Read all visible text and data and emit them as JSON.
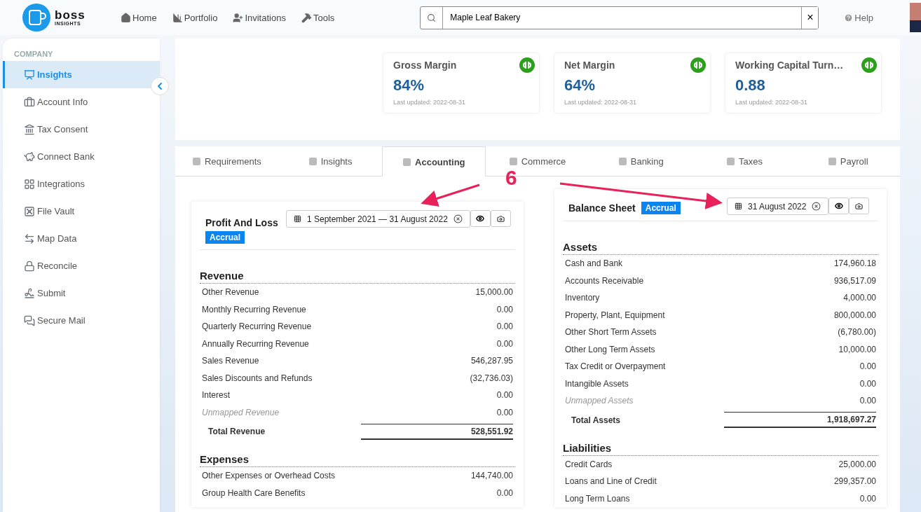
{
  "header": {
    "logo": {
      "name": "boss",
      "tagline": "INSIGHTS"
    },
    "nav": [
      {
        "label": "Home"
      },
      {
        "label": "Portfolio"
      },
      {
        "label": "Invitations"
      },
      {
        "label": "Tools"
      }
    ],
    "search": {
      "value": "Maple Leaf Bakery",
      "clear": "×"
    },
    "help": "Help"
  },
  "sidebar": {
    "section": "COMPANY",
    "items": [
      {
        "label": "Insights",
        "selected": true
      },
      {
        "label": "Account Info",
        "selected": false
      },
      {
        "label": "Tax Consent",
        "selected": false
      },
      {
        "label": "Connect Bank",
        "selected": false
      },
      {
        "label": "Integrations",
        "selected": false
      },
      {
        "label": "File Vault",
        "selected": false
      },
      {
        "label": "Map Data",
        "selected": false
      },
      {
        "label": "Reconcile",
        "selected": false
      },
      {
        "label": "Submit",
        "selected": false
      },
      {
        "label": "Secure Mail",
        "selected": false
      }
    ]
  },
  "metrics": [
    {
      "title": "Gross Margin",
      "value": "84%",
      "updated": "Last updated: 2022-08-31"
    },
    {
      "title": "Net Margin",
      "value": "64%",
      "updated": "Last updated: 2022-08-31"
    },
    {
      "title": "Working Capital Turn…",
      "value": "0.88",
      "updated": "Last updated: 2022-08-31"
    }
  ],
  "tabs": [
    {
      "label": "Requirements",
      "selected": false
    },
    {
      "label": "Insights",
      "selected": false
    },
    {
      "label": "Accounting",
      "selected": true
    },
    {
      "label": "Commerce",
      "selected": false
    },
    {
      "label": "Banking",
      "selected": false
    },
    {
      "label": "Taxes",
      "selected": false
    },
    {
      "label": "Payroll",
      "selected": false
    }
  ],
  "annotation": {
    "label": "6"
  },
  "profit_and_loss": {
    "title": "Profit And Loss",
    "basis": "Accrual",
    "date": "1 September 2021 — 31 August 2022",
    "sections": [
      {
        "heading": "Revenue",
        "rows": [
          {
            "kind": "row",
            "label": "Other Revenue",
            "value": "15,000.00"
          },
          {
            "kind": "row",
            "label": "Monthly Recurring Revenue",
            "value": "0.00"
          },
          {
            "kind": "row",
            "label": "Quarterly Recurring Revenue",
            "value": "0.00"
          },
          {
            "kind": "row",
            "label": "Annually Recurring Revenue",
            "value": "0.00"
          },
          {
            "kind": "row",
            "label": "Sales Revenue",
            "value": "546,287.95"
          },
          {
            "kind": "row",
            "label": "Sales Discounts and Refunds",
            "value": "(32,736.03)"
          },
          {
            "kind": "row",
            "label": "Interest",
            "value": "0.00"
          },
          {
            "kind": "unmapped",
            "label": "Unmapped Revenue",
            "value": "0.00"
          },
          {
            "kind": "total",
            "label": "Total Revenue",
            "value": "528,551.92"
          }
        ]
      },
      {
        "heading": "Expenses",
        "rows": [
          {
            "kind": "row",
            "label": "Other Expenses or Overhead Costs",
            "value": "144,740.00"
          },
          {
            "kind": "row",
            "label": "Group Health Care Benefits",
            "value": "0.00"
          }
        ]
      }
    ]
  },
  "balance_sheet": {
    "title": "Balance Sheet",
    "basis": "Accrual",
    "date": "31 August 2022",
    "sections": [
      {
        "heading": "Assets",
        "rows": [
          {
            "kind": "row",
            "label": "Cash and Bank",
            "value": "174,960.18"
          },
          {
            "kind": "row",
            "label": "Accounts Receivable",
            "value": "936,517.09"
          },
          {
            "kind": "row",
            "label": "Inventory",
            "value": "4,000.00"
          },
          {
            "kind": "row",
            "label": "Property, Plant, Equipment",
            "value": "800,000.00"
          },
          {
            "kind": "row",
            "label": "Other Short Term Assets",
            "value": "(6,780.00)"
          },
          {
            "kind": "row",
            "label": "Other Long Term Assets",
            "value": "10,000.00"
          },
          {
            "kind": "row",
            "label": "Tax Credit or Overpayment",
            "value": "0.00"
          },
          {
            "kind": "row",
            "label": "Intangible Assets",
            "value": "0.00"
          },
          {
            "kind": "unmapped",
            "label": "Unmapped Assets",
            "value": "0.00"
          },
          {
            "kind": "total",
            "label": "Total Assets",
            "value": "1,918,697.27"
          }
        ]
      },
      {
        "heading": "Liabilities",
        "rows": [
          {
            "kind": "row",
            "label": "Credit Cards",
            "value": "25,000.00"
          },
          {
            "kind": "row",
            "label": "Loans and Line of Credit",
            "value": "299,357.00"
          },
          {
            "kind": "row",
            "label": "Long Term Loans",
            "value": "0.00"
          }
        ]
      }
    ]
  }
}
